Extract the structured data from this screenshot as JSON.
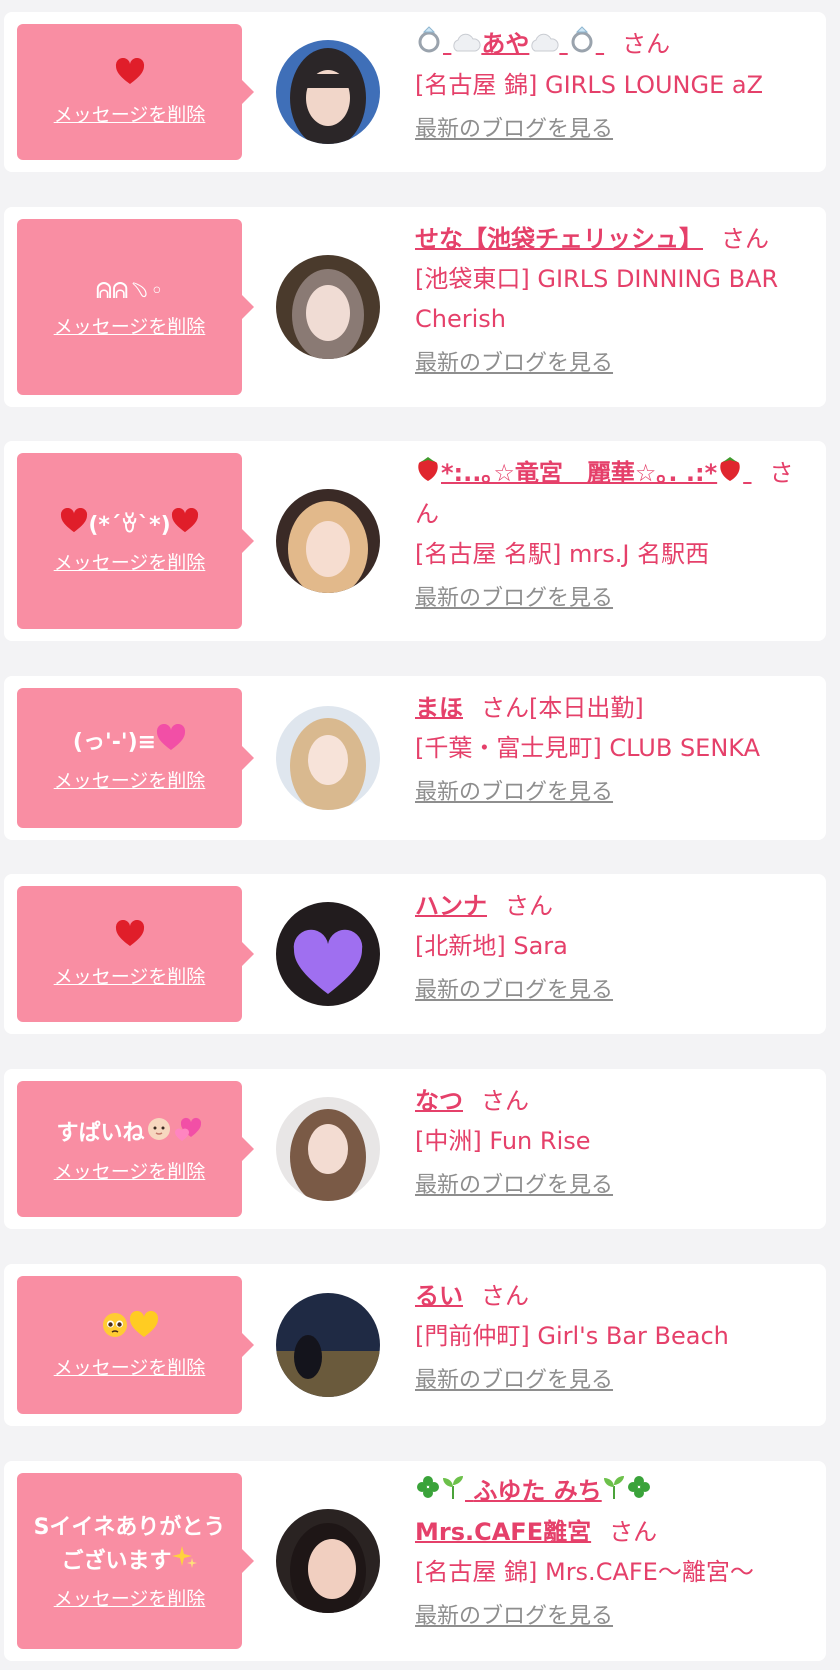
{
  "common": {
    "delete_label": "メッセージを削除",
    "blog_label": "最新のブログを見る",
    "san": "さん"
  },
  "colors": {
    "bubble": "#f98ea3",
    "accent": "#e5406a",
    "link_gray": "#8e8e8e",
    "background": "#f3f3f5"
  },
  "items": [
    {
      "message": "",
      "message_icons": [
        "red-heart-icon"
      ],
      "name": "あや",
      "name_icons": [
        "ring-icon",
        "cloud-icon",
        "cloud-icon",
        "ring-icon"
      ],
      "shop": "[名古屋 錦] GIRLS LOUNGE aZ"
    },
    {
      "message": "ᕱᕱ﹆◦",
      "name": "せな【池袋チェリッシュ】",
      "shop": "[池袋東口] GIRLS DINNING BAR Cherish"
    },
    {
      "message": "(*´ꈊ`*)",
      "message_icons": [
        "red-heart-icon",
        "red-heart-icon"
      ],
      "name": "*:..｡☆竜宮　麗華☆｡. .:*",
      "name_icons": [
        "strawberry-icon",
        "strawberry-icon"
      ],
      "shop": "[名古屋 名駅] mrs.J 名駅西"
    },
    {
      "message": "(っ'-')≡",
      "message_icons": [
        "pink-heart-icon"
      ],
      "name": "まほ",
      "san_suffix": "[本日出勤]",
      "shop": "[千葉・富士見町] CLUB SENKA"
    },
    {
      "message": "",
      "message_icons": [
        "red-heart-icon"
      ],
      "name": "ハンナ",
      "shop": "[北新地] Sara"
    },
    {
      "message": "すぱいね",
      "message_icons": [
        "baby-icon",
        "two-hearts-icon"
      ],
      "name": "なつ",
      "shop": "[中洲] Fun Rise"
    },
    {
      "message": "",
      "message_icons": [
        "pleading-face-icon",
        "yellow-heart-icon"
      ],
      "name": "るい",
      "shop": "[門前仲町] Girl's Bar Beach"
    },
    {
      "message": "Sイイネありがとうございます",
      "message_icons": [
        "sparkles-icon"
      ],
      "name": "ふゆた みち",
      "name2": "Mrs.CAFE離宮",
      "name_icons": [
        "clover-icon",
        "seedling-icon",
        "seedling-icon",
        "clover-icon"
      ],
      "shop": "[名古屋 錦] Mrs.CAFE〜離宮〜"
    }
  ]
}
